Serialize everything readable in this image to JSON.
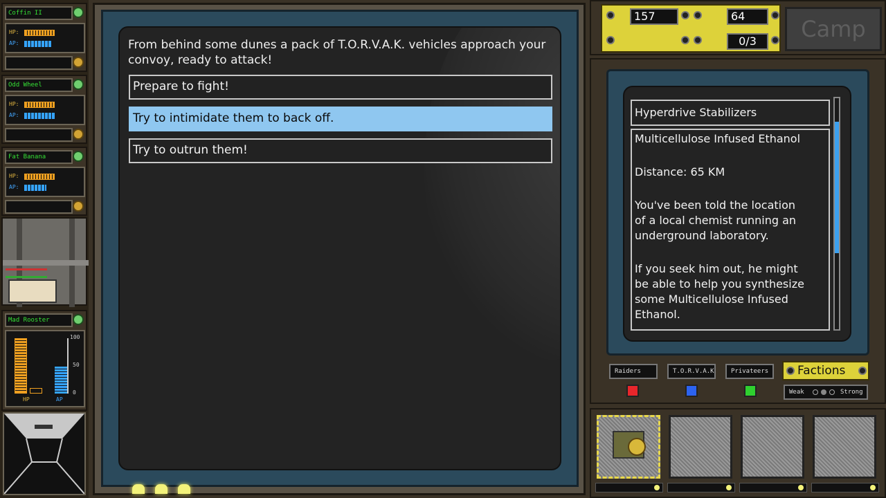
{
  "crew": [
    {
      "name": "Coffin II",
      "hp_label": "HP:",
      "ap_label": "AP:",
      "hp_fraction": 0.95,
      "ap_fraction": 0.8
    },
    {
      "name": "Odd Wheel",
      "hp_label": "HP:",
      "ap_label": "AP:",
      "hp_fraction": 0.95,
      "ap_fraction": 0.95
    },
    {
      "name": "Fat Banana",
      "hp_label": "HP:",
      "ap_label": "AP:",
      "hp_fraction": 0.95,
      "ap_fraction": 0.65
    }
  ],
  "selected_crew": {
    "name": "Mad Rooster",
    "hp_label": "HP",
    "ap_label": "AP",
    "scale": [
      "100",
      "50",
      "0"
    ],
    "hp_fraction": 0.92,
    "ap_fraction": 0.45
  },
  "event": {
    "text": "From behind some dunes a pack of T.O.R.V.A.K. vehicles approach your convoy, ready to attack!",
    "choices": [
      {
        "label": "Prepare to fight!",
        "selected": false
      },
      {
        "label": "Try to intimidate them to back off.",
        "selected": true
      },
      {
        "label": "Try to outrun them!",
        "selected": false
      }
    ]
  },
  "resources": {
    "scrap": "157",
    "fuel": "64",
    "cargo": "0/3",
    "scrap_icon": "gear-icon",
    "fuel_icon": "fuel-can-icon",
    "cargo_icon": "crate-icon"
  },
  "camp_label": "Camp",
  "quest": {
    "title": "Hyperdrive Stabilizers",
    "name": "Multicellulose Infused Ethanol",
    "distance": "Distance: 65 KM",
    "desc1": "You've been told the location\nof a local chemist running an\nunderground laboratory.",
    "desc2": "If you seek him out, he might\nbe able to help you synthesize\nsome Multicellulose Infused\nEthanol."
  },
  "factions": {
    "button_label": "Factions",
    "items": [
      {
        "name": "Raiders",
        "color": "#e8262b"
      },
      {
        "name": "T.O.R.V.A.K",
        "color": "#2c63f0"
      },
      {
        "name": "Privateers",
        "color": "#2fd02f"
      }
    ],
    "legend_weak": "Weak",
    "legend_strong": "Strong"
  },
  "colors": {
    "accent": "#ddd23a",
    "selection": "#8fc7f0",
    "hp": "#f0a020",
    "ap": "#35a4ff"
  }
}
